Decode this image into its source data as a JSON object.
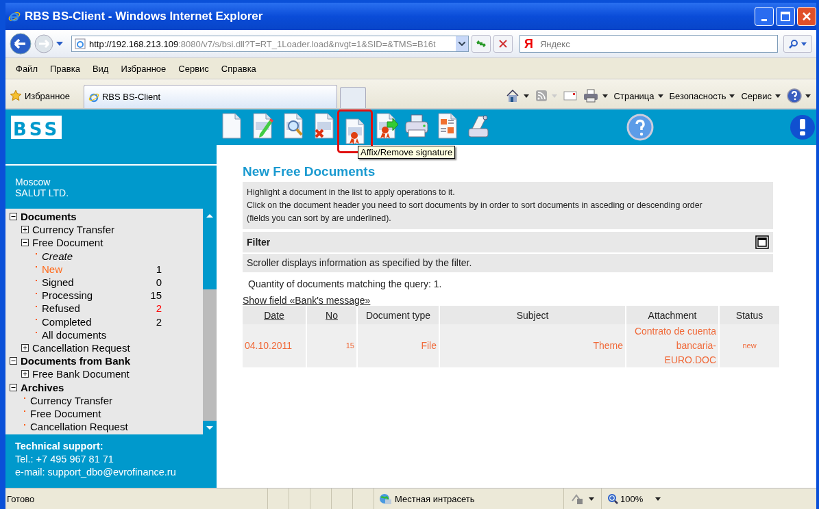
{
  "window": {
    "title": "RBS BS-Client - Windows Internet Explorer"
  },
  "address_bar": {
    "host": "http://192.168.213.109",
    "rest": ":8080/v7/s/bsi.dll?T=RT_1Loader.load&nvgt=1&SID=&TMS=B16t",
    "search_placeholder": "Яндекс",
    "search_logo": "Я"
  },
  "menu": [
    "Файл",
    "Правка",
    "Вид",
    "Избранное",
    "Сервис",
    "Справка"
  ],
  "favorites": {
    "label": "Избранное",
    "tab": "RBS BS-Client"
  },
  "command_bar": [
    "Страница",
    "Безопасность",
    "Сервис"
  ],
  "app": {
    "logo": "BSS",
    "toolbar": [
      {
        "kind": "new",
        "highlighted": false
      },
      {
        "kind": "edit",
        "highlighted": false
      },
      {
        "kind": "view",
        "highlighted": false
      },
      {
        "kind": "delete",
        "highlighted": false
      },
      {
        "kind": "sign",
        "highlighted": true
      },
      {
        "kind": "send",
        "highlighted": false
      },
      {
        "kind": "print",
        "highlighted": false
      },
      {
        "kind": "report",
        "highlighted": false
      },
      {
        "kind": "scroll",
        "highlighted": false
      }
    ],
    "tooltip": "Affix/Remove signature",
    "location": [
      "Moscow",
      "SALUT LTD."
    ],
    "tree": [
      {
        "label": "Documents",
        "kind": "folder",
        "expanded": true,
        "children": [
          {
            "label": "Currency Transfer",
            "kind": "folder",
            "expanded": false
          },
          {
            "label": "Free Document",
            "kind": "folder",
            "expanded": true,
            "children": [
              {
                "label": "Create",
                "kind": "action",
                "selected": false
              },
              {
                "label": "New",
                "kind": "link",
                "selected": true,
                "count": "1",
                "color": "#000000"
              },
              {
                "label": "Signed",
                "kind": "link",
                "selected": false,
                "count": "0",
                "color": "#000000"
              },
              {
                "label": "Processing",
                "kind": "link",
                "selected": false,
                "count": "15",
                "color": "#000000"
              },
              {
                "label": "Refused",
                "kind": "link",
                "selected": false,
                "count": "2",
                "color": "#ff0000"
              },
              {
                "label": "Completed",
                "kind": "link",
                "selected": false,
                "count": "2",
                "color": "#000000"
              },
              {
                "label": "All documents",
                "kind": "link",
                "selected": false
              }
            ]
          },
          {
            "label": "Cancellation Request",
            "kind": "folder",
            "expanded": false
          }
        ]
      },
      {
        "label": "Documents from Bank",
        "kind": "folder",
        "expanded": true,
        "children": [
          {
            "label": "Free Bank Document",
            "kind": "folder",
            "expanded": false
          }
        ]
      },
      {
        "label": "Archives",
        "kind": "folder",
        "expanded": true,
        "children": [
          {
            "label": "Currency Transfer",
            "kind": "link",
            "selected": false
          },
          {
            "label": "Free Document",
            "kind": "link",
            "selected": false
          },
          {
            "label": "Cancellation Request",
            "kind": "link",
            "selected": false
          }
        ]
      }
    ],
    "support": {
      "title": "Technical support:",
      "phone": "Tel.: +7 495 967 81 71",
      "email": "e-mail: support_dbo@evrofinance.ru"
    },
    "main": {
      "title": "New Free Documents",
      "hints": [
        "Highlight a document in the list to apply operations to it.",
        "Click on the document header you need to sort documents by in order to sort documents in asceding or descending order",
        "(fields you can sort by are underlined)."
      ],
      "filter": {
        "label": "Filter",
        "description": "Scroller displays information as specified by the filter."
      },
      "quantity": "Quantity  of documents  matching the query:  1.",
      "show_field": "Show field «Bank's message»",
      "columns": [
        {
          "label": "Date",
          "sortable": true
        },
        {
          "label": "No",
          "sortable": true
        },
        {
          "label": "Document type",
          "sortable": false
        },
        {
          "label": "Subject",
          "sortable": false
        },
        {
          "label": "Attachment",
          "sortable": false
        },
        {
          "label": "Status",
          "sortable": false
        }
      ],
      "rows": [
        {
          "cells": [
            "04.10.2011",
            "15",
            "File",
            "Theme",
            "Contrato de cuenta bancaria-EURO.DOC",
            "new"
          ]
        }
      ]
    }
  },
  "status_bar": {
    "status": "Готово",
    "zone": "Местная интрасеть",
    "zoom": "100%"
  }
}
